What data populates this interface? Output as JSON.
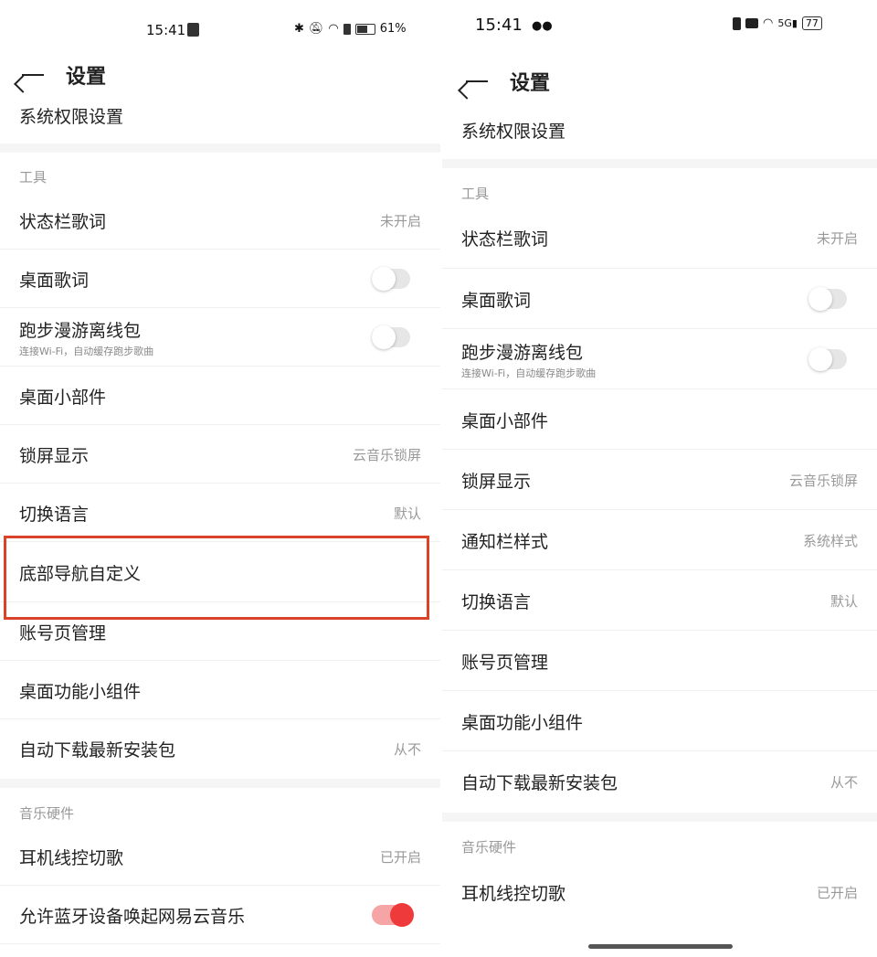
{
  "left": {
    "status": {
      "time": "15:41",
      "icons": [
        "upload-icon",
        "bluetooth-icon",
        "mute-icon",
        "wifi-icon",
        "alert-icon",
        "battery-icon"
      ],
      "battery": "61%"
    },
    "header": {
      "title": "设置"
    },
    "top_item": "系统权限设置",
    "section_tools": "工具",
    "items": [
      {
        "label": "状态栏歌词",
        "value": "未开启"
      },
      {
        "label": "桌面歌词",
        "toggle": "off"
      },
      {
        "label": "跑步漫游离线包",
        "sub": "连接Wi-Fi，自动缓存跑步歌曲",
        "toggle": "off"
      },
      {
        "label": "桌面小部件"
      },
      {
        "label": "锁屏显示",
        "value": "云音乐锁屏"
      },
      {
        "label": "切换语言",
        "value": "默认"
      },
      {
        "label": "底部导航自定义"
      },
      {
        "label": "账号页管理"
      },
      {
        "label": "桌面功能小组件"
      },
      {
        "label": "自动下载最新安装包",
        "value": "从不"
      }
    ],
    "section_hw": "音乐硬件",
    "hw_items": [
      {
        "label": "耳机线控切歌",
        "value": "已开启"
      },
      {
        "label": "允许蓝牙设备唤起网易云音乐",
        "toggle": "on"
      }
    ]
  },
  "right": {
    "status": {
      "time": "15:41",
      "icons": [
        "wechat-icon",
        "vibrate-icon",
        "hd-icon",
        "wifi-icon",
        "signal-5g-icon",
        "battery-icon"
      ],
      "battery": "77"
    },
    "header": {
      "title": "设置"
    },
    "top_item": "系统权限设置",
    "section_tools": "工具",
    "items": [
      {
        "label": "状态栏歌词",
        "value": "未开启"
      },
      {
        "label": "桌面歌词",
        "toggle": "off"
      },
      {
        "label": "跑步漫游离线包",
        "sub": "连接Wi-Fi，自动缓存跑步歌曲",
        "toggle": "off"
      },
      {
        "label": "桌面小部件"
      },
      {
        "label": "锁屏显示",
        "value": "云音乐锁屏"
      },
      {
        "label": "通知栏样式",
        "value": "系统样式"
      },
      {
        "label": "切换语言",
        "value": "默认"
      },
      {
        "label": "账号页管理"
      },
      {
        "label": "桌面功能小组件"
      },
      {
        "label": "自动下载最新安装包",
        "value": "从不"
      }
    ],
    "section_hw": "音乐硬件",
    "hw_items": [
      {
        "label": "耳机线控切歌",
        "value": "已开启"
      }
    ]
  },
  "colors": {
    "accent": "#ee3a3a",
    "highlight": "#d9432a",
    "secondary": "#999999"
  }
}
